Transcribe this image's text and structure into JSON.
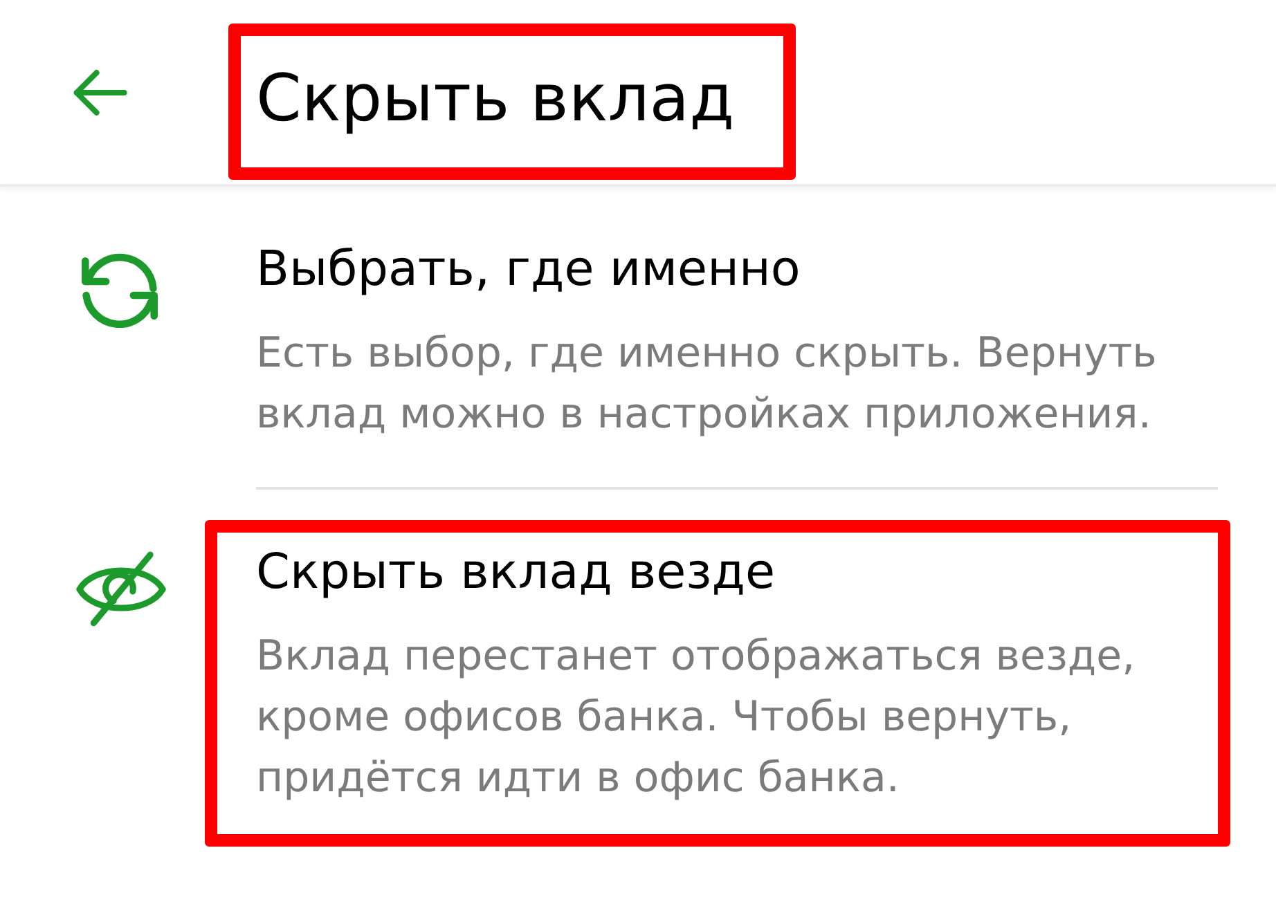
{
  "header": {
    "title": "Скрыть вклад",
    "highlighted": true
  },
  "options": [
    {
      "kind": "refresh",
      "title": "Выбрать, где именно",
      "description": "Есть выбор, где именно скрыть. Вернуть вклад можно в настройках приложения.",
      "highlighted": false
    },
    {
      "kind": "hide",
      "title": "Скрыть вклад везде",
      "description": "Вклад перестанет отображаться везде, кроме офисов банка. Чтобы вернуть, придётся идти в офис банка.",
      "highlighted": true
    }
  ]
}
